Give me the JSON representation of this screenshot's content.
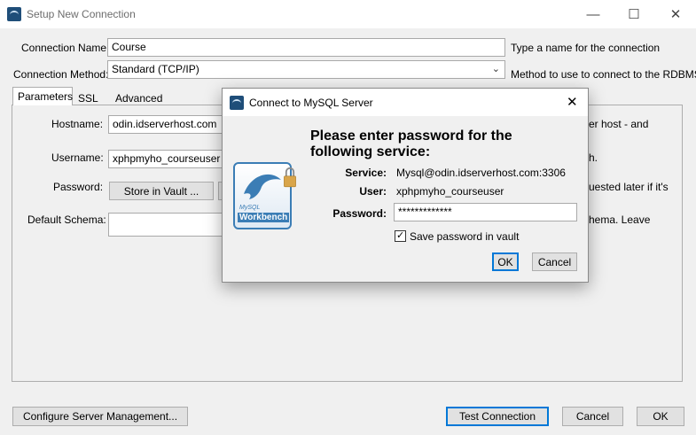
{
  "window": {
    "title": "Setup New Connection",
    "minimize_icon": "minimize-icon",
    "maximize_icon": "maximize-icon",
    "close_icon": "close-icon"
  },
  "form": {
    "connection_name_label": "Connection Name:",
    "connection_name_value": "Course",
    "connection_name_hint": "Type a name for the connection",
    "connection_method_label": "Connection Method:",
    "connection_method_value": "Standard (TCP/IP)",
    "connection_method_hint": "Method to use to connect to the RDBMS"
  },
  "tabs": [
    {
      "label": "Parameters",
      "active": true
    },
    {
      "label": "SSL",
      "active": false
    },
    {
      "label": "Advanced",
      "active": false
    }
  ],
  "parameters": {
    "hostname_label": "Hostname:",
    "hostname_value": "odin.idserverhost.com",
    "hostname_hint_fragment": "er host - and",
    "username_label": "Username:",
    "username_value": "xphpmyho_courseuser",
    "username_hint_fragment": "h.",
    "password_label": "Password:",
    "store_in_vault_button": "Store in Vault ...",
    "password_hint_fragment": "uested later if it's",
    "default_schema_label": "Default Schema:",
    "default_schema_value": "",
    "default_schema_hint_fragment": "hema. Leave"
  },
  "footer": {
    "configure_button": "Configure Server Management...",
    "test_button": "Test Connection",
    "cancel_button": "Cancel",
    "ok_button": "OK"
  },
  "dialog": {
    "title": "Connect to MySQL Server",
    "heading_line1": "Please enter password for the",
    "heading_line2": "following service:",
    "service_label": "Service:",
    "service_value": "Mysql@odin.idserverhost.com:3306",
    "user_label": "User:",
    "user_value": "xphpmyho_courseuser",
    "password_label": "Password:",
    "password_value": "*************",
    "save_label": "Save password in vault",
    "save_checked": true,
    "ok_button": "OK",
    "cancel_button": "Cancel",
    "logo_text": "Workbench",
    "logo_small": "MySQL"
  },
  "colors": {
    "accent": "#0078d7",
    "logo_blue": "#3b7db5"
  }
}
